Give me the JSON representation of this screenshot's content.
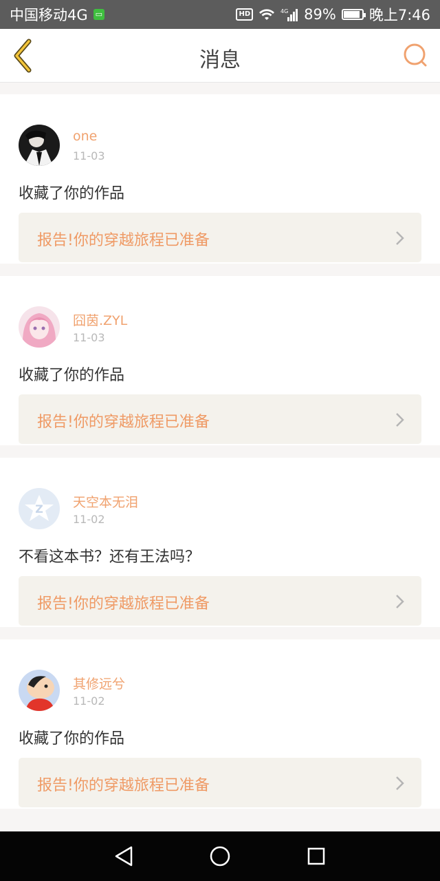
{
  "status_bar": {
    "carrier": "中国移动4G",
    "badge": "HD",
    "signal": "4G",
    "battery": "89%",
    "time": "晚上7:46",
    "hd_label": "HD"
  },
  "header": {
    "title": "消息",
    "back_icon": "back-chevron-icon",
    "search_icon": "search-icon",
    "accent_color": "#f0a26f"
  },
  "messages": [
    {
      "username": "one",
      "date": "11-03",
      "text": "收藏了你的作品",
      "link": "报告!你的穿越旅程已准备"
    },
    {
      "username": "囧茵.ZYL",
      "date": "11-03",
      "text": "收藏了你的作品",
      "link": "报告!你的穿越旅程已准备"
    },
    {
      "username": "天空本无泪",
      "date": "11-02",
      "text": "不看这本书？还有王法吗？",
      "link": "报告!你的穿越旅程已准备"
    },
    {
      "username": "其修远兮",
      "date": "11-02",
      "text": "收藏了你的作品",
      "link": "报告!你的穿越旅程已准备"
    }
  ],
  "nav_bar": {
    "back": "nav-back-icon",
    "home": "nav-home-icon",
    "recents": "nav-recents-icon"
  }
}
